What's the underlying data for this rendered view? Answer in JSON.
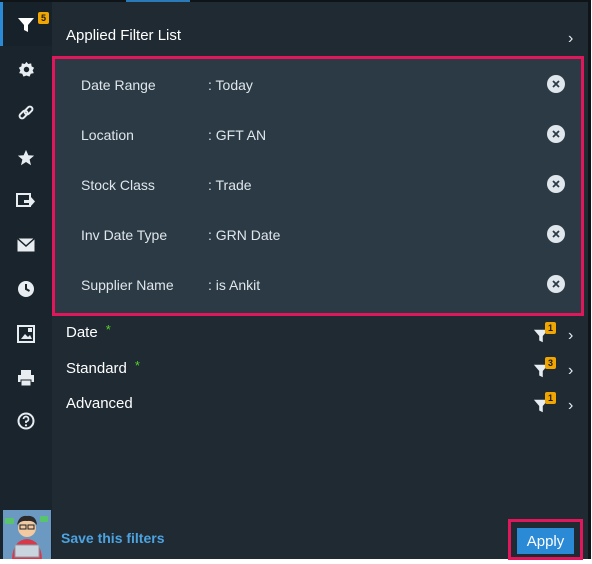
{
  "rail": {
    "filter_badge": "5",
    "icons": [
      "filter-icon",
      "gear-icon",
      "link-icon",
      "star-icon",
      "export-icon",
      "envelope-icon",
      "clock-icon",
      "image-icon",
      "print-icon",
      "help-icon"
    ]
  },
  "header": {
    "title": "Applied Filter List"
  },
  "applied_filters": [
    {
      "label": "Date Range",
      "value": ": Today"
    },
    {
      "label": "Location",
      "value": ": GFT AN"
    },
    {
      "label": "Stock Class",
      "value": ": Trade"
    },
    {
      "label": "Inv Date Type",
      "value": ": GRN Date"
    },
    {
      "label": "Supplier Name",
      "value": ": is Ankit"
    }
  ],
  "groups": [
    {
      "label": "Date",
      "required": "*",
      "count": "1"
    },
    {
      "label": "Standard",
      "required": "*",
      "count": "3"
    },
    {
      "label": "Advanced",
      "count": "1"
    }
  ],
  "footer": {
    "save_label": "Save this filters",
    "apply_label": "Apply"
  },
  "colors": {
    "accent": "#2a8ad6",
    "highlight_border": "#e0175a",
    "badge": "#f0a500",
    "required": "#58d12b",
    "link": "#4da3e0"
  }
}
